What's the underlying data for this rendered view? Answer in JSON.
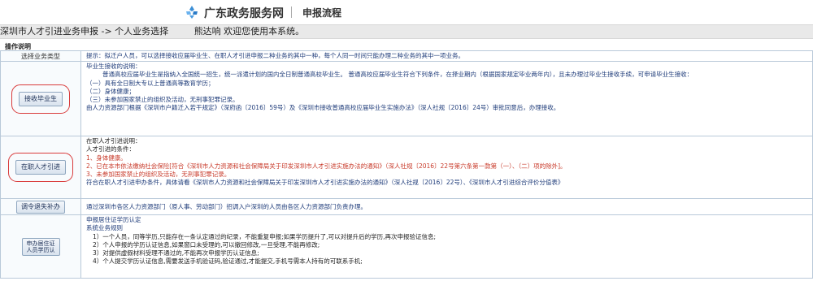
{
  "header": {
    "brand": "广东政务服务网",
    "flow": "申报流程"
  },
  "breadcrumb": {
    "text": "深圳市人才引进业务申报 -> 个人业务选择",
    "greeting": "熊达响 欢迎您使用本系统。"
  },
  "section_title": "操作说明",
  "table": {
    "row0": {
      "label": "选择业务类型",
      "text": "提示：拟迁户人员，可以选择接收应届毕业生、在职人才引进申报二种业务的其中一种，每个人同一时间只能办理二种业务的其中一项业务。"
    },
    "row1": {
      "button": "接收毕业生",
      "lines": [
        "毕业生接收的说明：",
        "普通高校应届毕业生是指纳入全国统一招生，统一派遣计划的国内全日制普通高校毕业生。 普通高校应届毕业生符合下列条件，在择业期内（根据国家规定毕业两年内），且未办理过毕业生接收手续，可申请毕业生接收：",
        "（一）具有全日制大专以上普通高等教育学历；",
        "（二）身体健康；",
        "（三）未参加国家禁止的组织及活动，无刑事犯罪记录。",
        "由人力资源部门根据《深圳市户籍迁入若干规定》（深府函〔2016〕59号）及《深圳市接收普通高校应届毕业生实施办法》（深人社规〔2016〕24号）审批同意后，办理接收。"
      ]
    },
    "row2": {
      "button": "在职人才引进",
      "lines": [
        "在职人才引进说明：",
        "人才引进的条件：",
        "1、身体健康。",
        "2、已在本市依法缴纳社会保险[符合《深圳市人力资源和社会保障局关于印发深圳市人才引进实施办法的通知》（深人社规〔2016〕22号第六条第一款第（一）、（二）项的除外]。",
        "3、未参加国家禁止的组织及活动，无刑事犯罪记录。",
        "符合在职人才引进申办条件，具体请看《深圳市人力资源和社会保障局关于印发深圳市人才引进实施办法的通知》（深人社规〔2016〕22号）、《深圳市人才引进综合评价分值表》"
      ]
    },
    "row3": {
      "button": "调令退失补办",
      "text": "通过深圳市各区人力资源部门（原人事、劳动部门）招调入户深圳的人员由各区人力资源部门负责办理。"
    },
    "row4": {
      "button": "申办居住证\n人员学历认",
      "lines": [
        "申报居住证学历认定",
        "系统业务规则",
        "1）一个人员，同等学历,只能存在一条认定通过的纪录，不能重复申报;如果学历提升了,可以对提升后的学历,再次申报验证信息;",
        "2）个人申报的学历认证信息,如果窗口未受理的,可以撤回修改,一旦受理,不能再修改;",
        "3）对提供虚假材料受理不通过的,不能再次申报学历认证信息;",
        "4）个人提交学历认证信息,需要发送手机验证码,验证通过,才能提交,手机号需本人持有的可联系手机;"
      ]
    }
  },
  "colors": {
    "accent_red": "#d93b3b",
    "link_blue": "#1f3c7a",
    "orange": "#cc5a18"
  }
}
